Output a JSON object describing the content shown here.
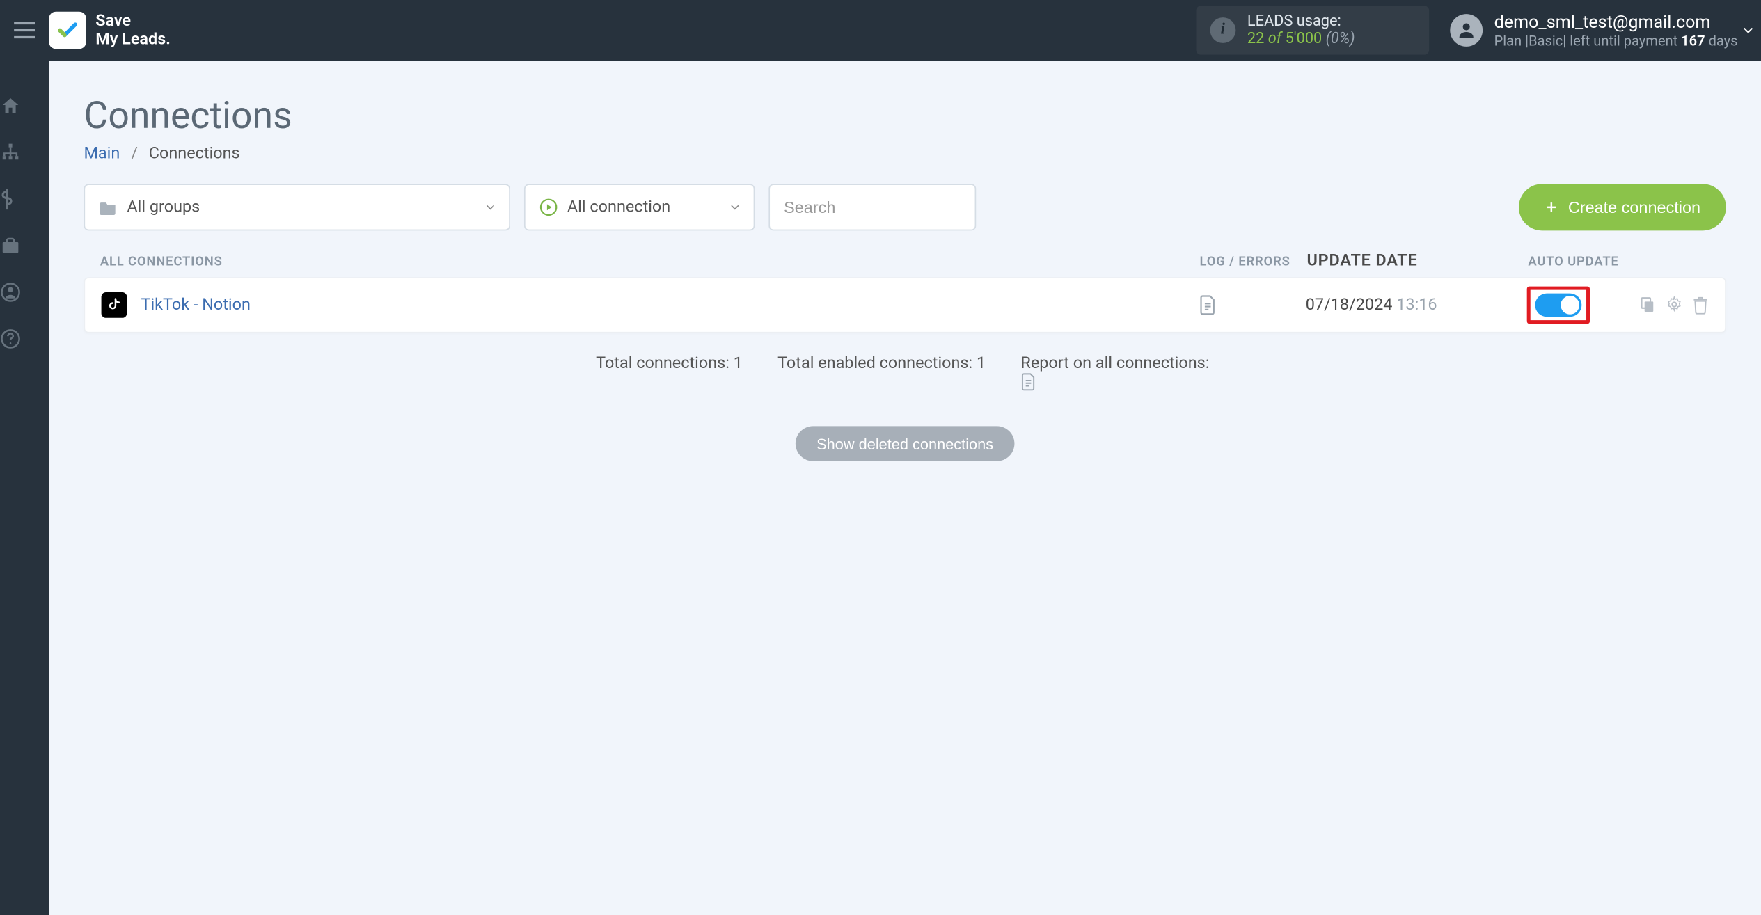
{
  "brand": {
    "line1": "Save",
    "line2": "My Leads."
  },
  "leads_usage": {
    "label": "LEADS usage:",
    "used": "22",
    "of": "of",
    "total": "5'000",
    "pct": "(0%)"
  },
  "account": {
    "email": "demo_sml_test@gmail.com",
    "plan_prefix": "Plan |",
    "plan_name": "Basic",
    "plan_mid": "| left until payment ",
    "days": "167",
    "days_suffix": " days"
  },
  "page": {
    "title": "Connections",
    "breadcrumb_main": "Main",
    "breadcrumb_current": "Connections"
  },
  "filters": {
    "groups_label": "All groups",
    "status_label": "All connection",
    "search_placeholder": "Search"
  },
  "buttons": {
    "create": "Create connection",
    "show_deleted": "Show deleted connections"
  },
  "table": {
    "head_all": "ALL CONNECTIONS",
    "head_log": "LOG / ERRORS",
    "head_date": "UPDATE DATE",
    "head_auto": "AUTO UPDATE"
  },
  "rows": [
    {
      "title": "TikTok - Notion",
      "date": "07/18/2024",
      "time": "13:16",
      "auto_on": true
    }
  ],
  "summary": {
    "total_connections_label": "Total connections: ",
    "total_connections_value": "1",
    "total_enabled_label": "Total enabled connections: ",
    "total_enabled_value": "1",
    "report_label": "Report on all connections: "
  }
}
